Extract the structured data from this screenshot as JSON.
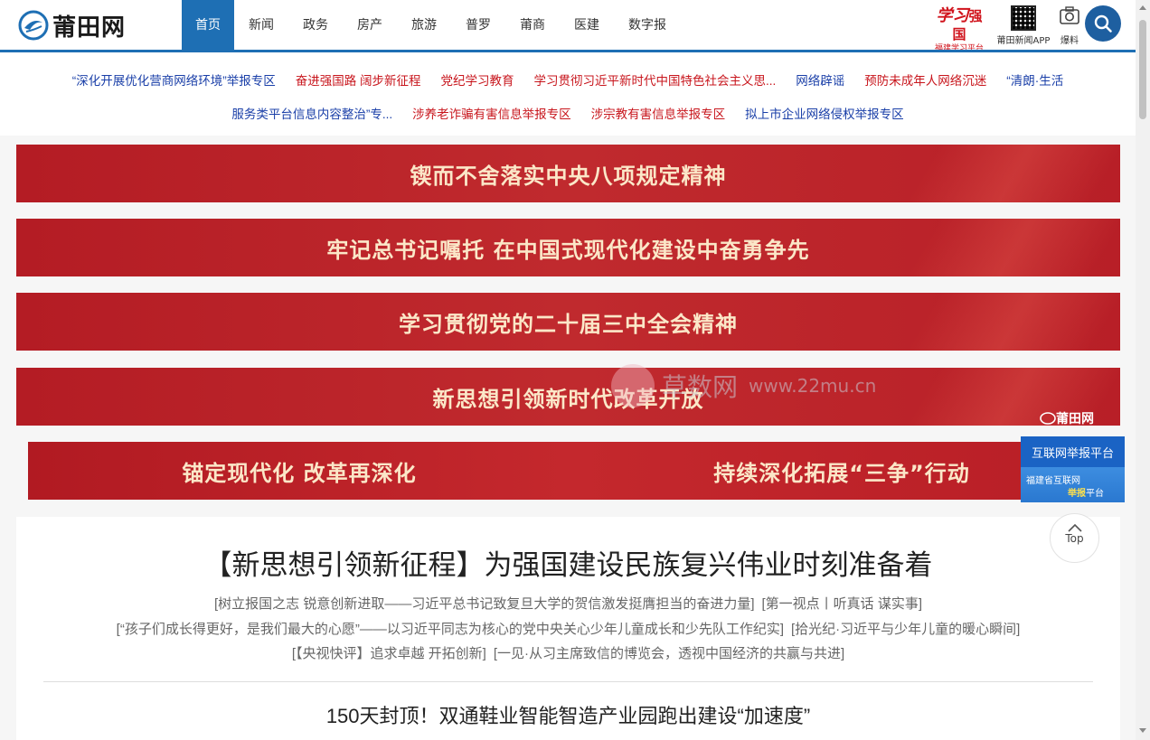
{
  "header": {
    "logo_text": "莆田网",
    "nav": [
      "首页",
      "新闻",
      "政务",
      "房产",
      "旅游",
      "普罗",
      "莆商",
      "医建",
      "数字报"
    ],
    "xxqg_prefix": "学习",
    "xxqg_suffix": "强国",
    "xxqg_sub": "福建学习平台",
    "app_label": "莆田新闻APP",
    "baoliao_label": "爆料"
  },
  "topics": {
    "row1": [
      {
        "text": "“深化开展优化营商网络环境”举报专区",
        "color": "blue"
      },
      {
        "text": "奋进强国路 阔步新征程",
        "color": "red"
      },
      {
        "text": "党纪学习教育",
        "color": "red"
      },
      {
        "text": "学习贯彻习近平新时代中国特色社会主义思...",
        "color": "red"
      },
      {
        "text": "网络辟谣",
        "color": "blue"
      },
      {
        "text": "预防未成年人网络沉迷",
        "color": "red"
      },
      {
        "text": "“清朗·生活",
        "color": "blue"
      }
    ],
    "row2": [
      {
        "text": "服务类平台信息内容整治”专...",
        "color": "blue"
      },
      {
        "text": "涉养老诈骗有害信息举报专区",
        "color": "red"
      },
      {
        "text": "涉宗教有害信息举报专区",
        "color": "red"
      },
      {
        "text": "拟上市企业网络侵权举报专区",
        "color": "blue"
      }
    ]
  },
  "banners": [
    "锲而不舍落实中央八项规定精神",
    "牢记总书记嘱托 在中国式现代化建设中奋勇争先",
    "学习贯彻党的二十届三中全会精神",
    "新思想引领新时代改革开放"
  ],
  "half_banners": [
    "锚定现代化 改革再深化",
    "持续深化拓展“三争”行动"
  ],
  "watermark": {
    "text": "草数网",
    "url": "www.22mu.cn"
  },
  "banner_logo": "莆田网",
  "news": {
    "headline": "【新思想引领新征程】为强国建设民族复兴伟业时刻准备着",
    "subs_row1": [
      "[树立报国之志 锐意创新进取——习近平总书记致复旦大学的贺信激发挺膺担当的奋进力量]",
      "[第一视点丨听真话 谋实事]"
    ],
    "subs_row2": [
      "[“孩子们成长得更好，是我们最大的心愿”——以习近平同志为核心的党中央关心少年儿童成长和少先队工作纪实]",
      "[拾光纪·习近平与少年儿童的暖心瞬间]"
    ],
    "subs_row3": [
      "[【央视快评】追求卓越 开拓创新]",
      "[一见·从习主席致信的博览会，透视中国经济的共赢与共进]"
    ],
    "headline2": "150天封顶！双通鞋业智能智造产业园跑出建设“加速度”"
  },
  "float": {
    "report_title": "互联网举报平台",
    "report_line1": "福建省互联网",
    "report_line2_a": "举报",
    "report_line2_b": "平台",
    "top_label": "Top"
  },
  "colors": {
    "brand_blue": "#1e6fb4",
    "banner_red": "#b41c24",
    "link_red": "#c8161d",
    "link_blue": "#1a3fa8"
  }
}
